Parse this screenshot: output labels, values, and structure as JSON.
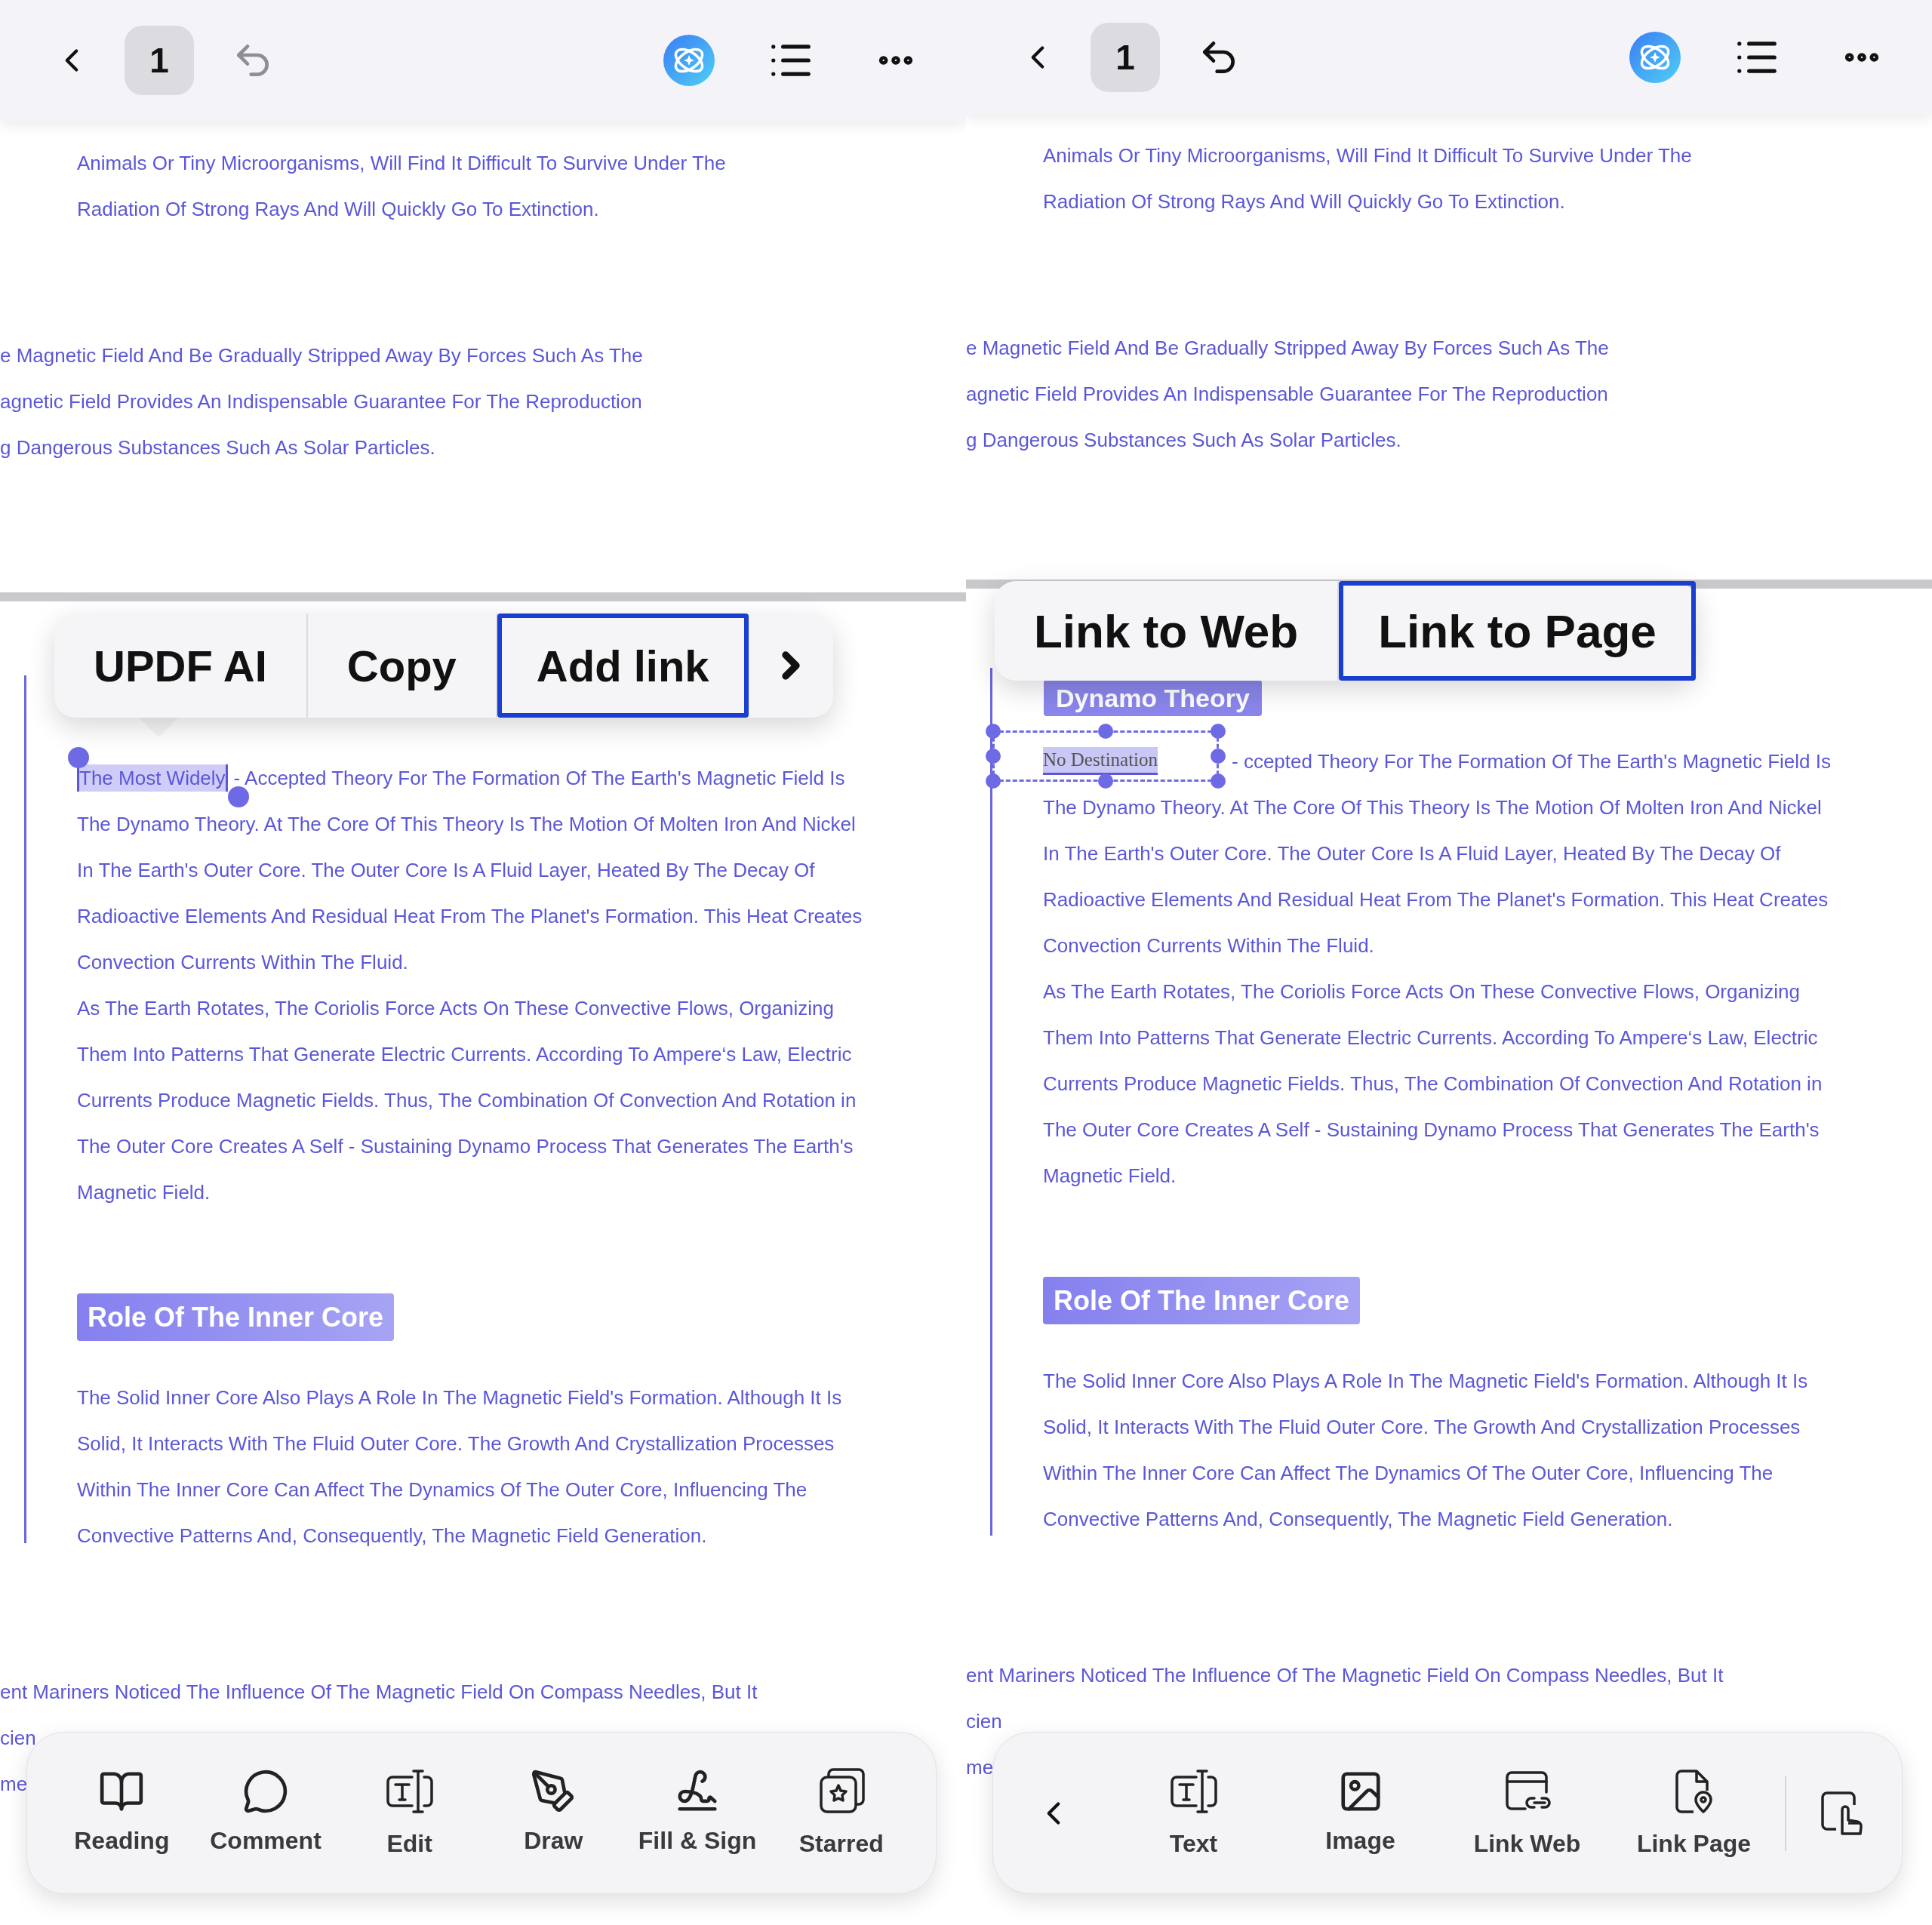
{
  "panels": [
    {
      "kind": "text_selection",
      "top_bar": {
        "page": "1",
        "undo_enabled": false
      },
      "page_top_lines": [
        "Animals Or Tiny Microorganisms, Will Find It Difficult To Survive Under The",
        "Radiation Of Strong Rays And Will Quickly Go To Extinction."
      ],
      "clipped_lines": [
        "e Magnetic Field And Be Gradually Stripped Away By Forces Such As The",
        "agnetic Field Provides An Indispensable Guarantee For The Reproduction",
        "g Dangerous Substances Such As Solar Particles."
      ],
      "menu": {
        "items": [
          {
            "label": "UPDF AI",
            "selected": false
          },
          {
            "label": "Copy",
            "selected": false
          },
          {
            "label": "Add link",
            "selected": true
          }
        ]
      },
      "first_line": {
        "marked": "The Most Widely",
        "rest": "- Accepted Theory For The Formation Of The Earth's Magnetic Field Is"
      },
      "paragraph_1": [
        "The Dynamo Theory. At The Core Of This Theory Is The Motion Of Molten Iron And Nickel",
        "In The Earth's Outer Core. The Outer Core Is A Fluid Layer, Heated By The Decay Of",
        "Radioactive Elements And Residual Heat From The Planet's Formation. This Heat Creates",
        "Convection Currents Within The Fluid.",
        "As The Earth Rotates, The Coriolis Force Acts On These Convective Flows, Organizing",
        "Them Into Patterns That Generate Electric Currents. According To Ampere‘s Law, Electric",
        "Currents Produce Magnetic Fields. Thus, The Combination Of Convection And Rotation in",
        "The Outer Core Creates A Self - Sustaining Dynamo Process That Generates The Earth's",
        "Magnetic Field."
      ],
      "heading": "Role Of The Inner Core",
      "paragraph_2": [
        "The Solid Inner Core Also Plays A Role In The Magnetic Field's Formation. Although It Is",
        "Solid, It Interacts With The Fluid Outer Core. The Growth And Crystallization Processes",
        "Within The Inner Core Can Affect The Dynamics Of The Outer Core, Influencing The",
        "Convective Patterns And, Consequently, The Magnetic Field Generation."
      ],
      "bottom_lines": [
        "ent Mariners Noticed The Influence Of The Magnetic Field On Compass Needles, But It",
        "cien",
        "me"
      ],
      "toolbar": {
        "items": [
          {
            "label": "Reading"
          },
          {
            "label": "Comment"
          },
          {
            "label": "Edit"
          },
          {
            "label": "Draw"
          },
          {
            "label": "Fill & Sign"
          },
          {
            "label": "Starred"
          }
        ]
      }
    },
    {
      "kind": "link_editing",
      "top_bar": {
        "page": "1",
        "undo_enabled": true
      },
      "page_top_lines": [
        "Animals Or Tiny Microorganisms, Will Find It Difficult To Survive Under The",
        "Radiation Of Strong Rays And Will Quickly Go To Extinction."
      ],
      "clipped_lines": [
        "e Magnetic Field And Be Gradually Stripped Away By Forces Such As The",
        "agnetic Field Provides An Indispensable Guarantee For The Reproduction",
        "g Dangerous Substances Such As Solar Particles."
      ],
      "menu": {
        "items": [
          {
            "label": "Link to Web",
            "selected": false
          },
          {
            "label": "Link to Page",
            "selected": true
          }
        ]
      },
      "section_heading": "Dynamo Theory",
      "first_line": {
        "marked": "No Destination",
        "rest": "- ccepted Theory For The Formation Of The Earth's Magnetic Field Is"
      },
      "paragraph_1": [
        "The Dynamo Theory. At The Core Of This Theory Is The Motion Of Molten Iron And Nickel",
        "In The Earth's Outer Core. The Outer Core Is A Fluid Layer, Heated By The Decay Of",
        "Radioactive Elements And Residual Heat From The Planet's Formation. This Heat Creates",
        "Convection Currents Within The Fluid.",
        "As The Earth Rotates, The Coriolis Force Acts On These Convective Flows, Organizing",
        "Them Into Patterns That Generate Electric Currents. According To Ampere‘s Law, Electric",
        "Currents Produce Magnetic Fields. Thus, The Combination Of Convection And Rotation in",
        "The Outer Core Creates A Self - Sustaining Dynamo Process That Generates The Earth's",
        "Magnetic Field."
      ],
      "heading": "Role Of The Inner Core",
      "paragraph_2": [
        "The Solid Inner Core Also Plays A Role In The Magnetic Field's Formation. Although It Is",
        "Solid, It Interacts With The Fluid Outer Core. The Growth And Crystallization Processes",
        "Within The Inner Core Can Affect The Dynamics Of The Outer Core, Influencing The",
        "Convective Patterns And, Consequently, The Magnetic Field Generation."
      ],
      "bottom_lines": [
        "ent Mariners Noticed The Influence Of The Magnetic Field On Compass Needles, But It",
        "cien",
        "me"
      ],
      "toolbar": {
        "items": [
          {
            "label": "Text"
          },
          {
            "label": "Image"
          },
          {
            "label": "Link Web"
          },
          {
            "label": "Link Page"
          }
        ]
      }
    }
  ]
}
